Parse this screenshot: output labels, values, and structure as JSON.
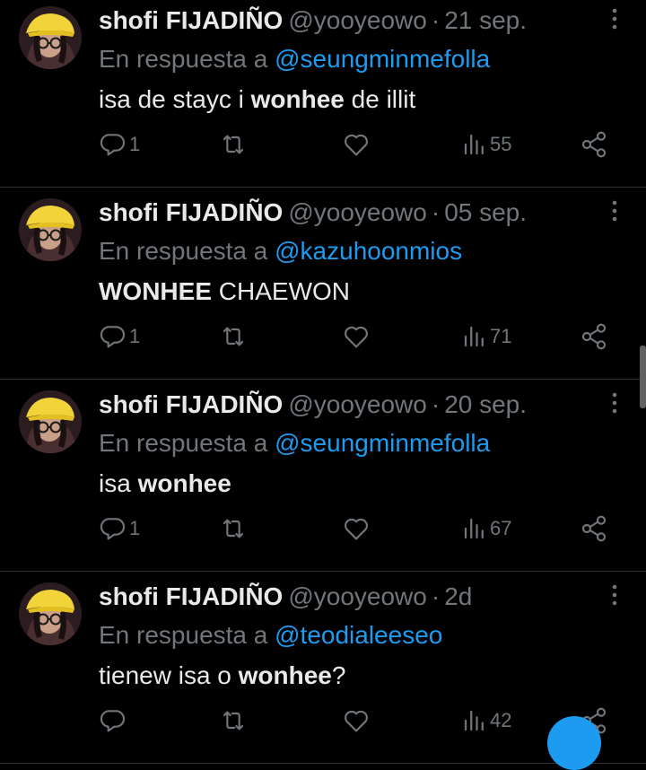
{
  "tweets": [
    {
      "name": "shofi FIJADIÑO",
      "handle": "@yooyeowo",
      "sep": "·",
      "date": "21 sep.",
      "reply_prefix": "En respuesta a ",
      "mention": "@seungminmefolla",
      "body": [
        {
          "text": "isa de stayc i ",
          "bold": false
        },
        {
          "text": "wonhee",
          "bold": true
        },
        {
          "text": " de illit",
          "bold": false
        }
      ],
      "replies": "1",
      "retweets": "",
      "likes": "",
      "views": "55"
    },
    {
      "name": "shofi FIJADIÑO",
      "handle": "@yooyeowo",
      "sep": "·",
      "date": "05 sep.",
      "reply_prefix": "En respuesta a ",
      "mention": "@kazuhoonmios",
      "body": [
        {
          "text": "WONHEE",
          "bold": true
        },
        {
          "text": " CHAEWON",
          "bold": false
        }
      ],
      "replies": "1",
      "retweets": "",
      "likes": "",
      "views": "71"
    },
    {
      "name": "shofi FIJADIÑO",
      "handle": "@yooyeowo",
      "sep": "·",
      "date": "20 sep.",
      "reply_prefix": "En respuesta a ",
      "mention": "@seungminmefolla",
      "body": [
        {
          "text": "isa ",
          "bold": false
        },
        {
          "text": "wonhee",
          "bold": true
        }
      ],
      "replies": "1",
      "retweets": "",
      "likes": "",
      "views": "67"
    },
    {
      "name": "shofi FIJADIÑO",
      "handle": "@yooyeowo",
      "sep": "·",
      "date": "2d",
      "reply_prefix": "En respuesta a ",
      "mention": "@teodialeeseo",
      "body": [
        {
          "text": "tienew isa o ",
          "bold": false
        },
        {
          "text": "wonhee",
          "bold": true
        },
        {
          "text": "?",
          "bold": false
        }
      ],
      "replies": "",
      "retweets": "",
      "likes": "",
      "views": "42"
    }
  ],
  "icons": {
    "more": "more-options-icon",
    "reply": "reply-icon",
    "retweet": "retweet-icon",
    "like": "heart-icon",
    "views": "views-bar-chart-icon",
    "share": "share-icon"
  },
  "colors": {
    "background": "#000000",
    "text": "#e7e9ea",
    "muted": "#71767b",
    "link": "#1d9bf0",
    "divider": "#2f3336"
  }
}
